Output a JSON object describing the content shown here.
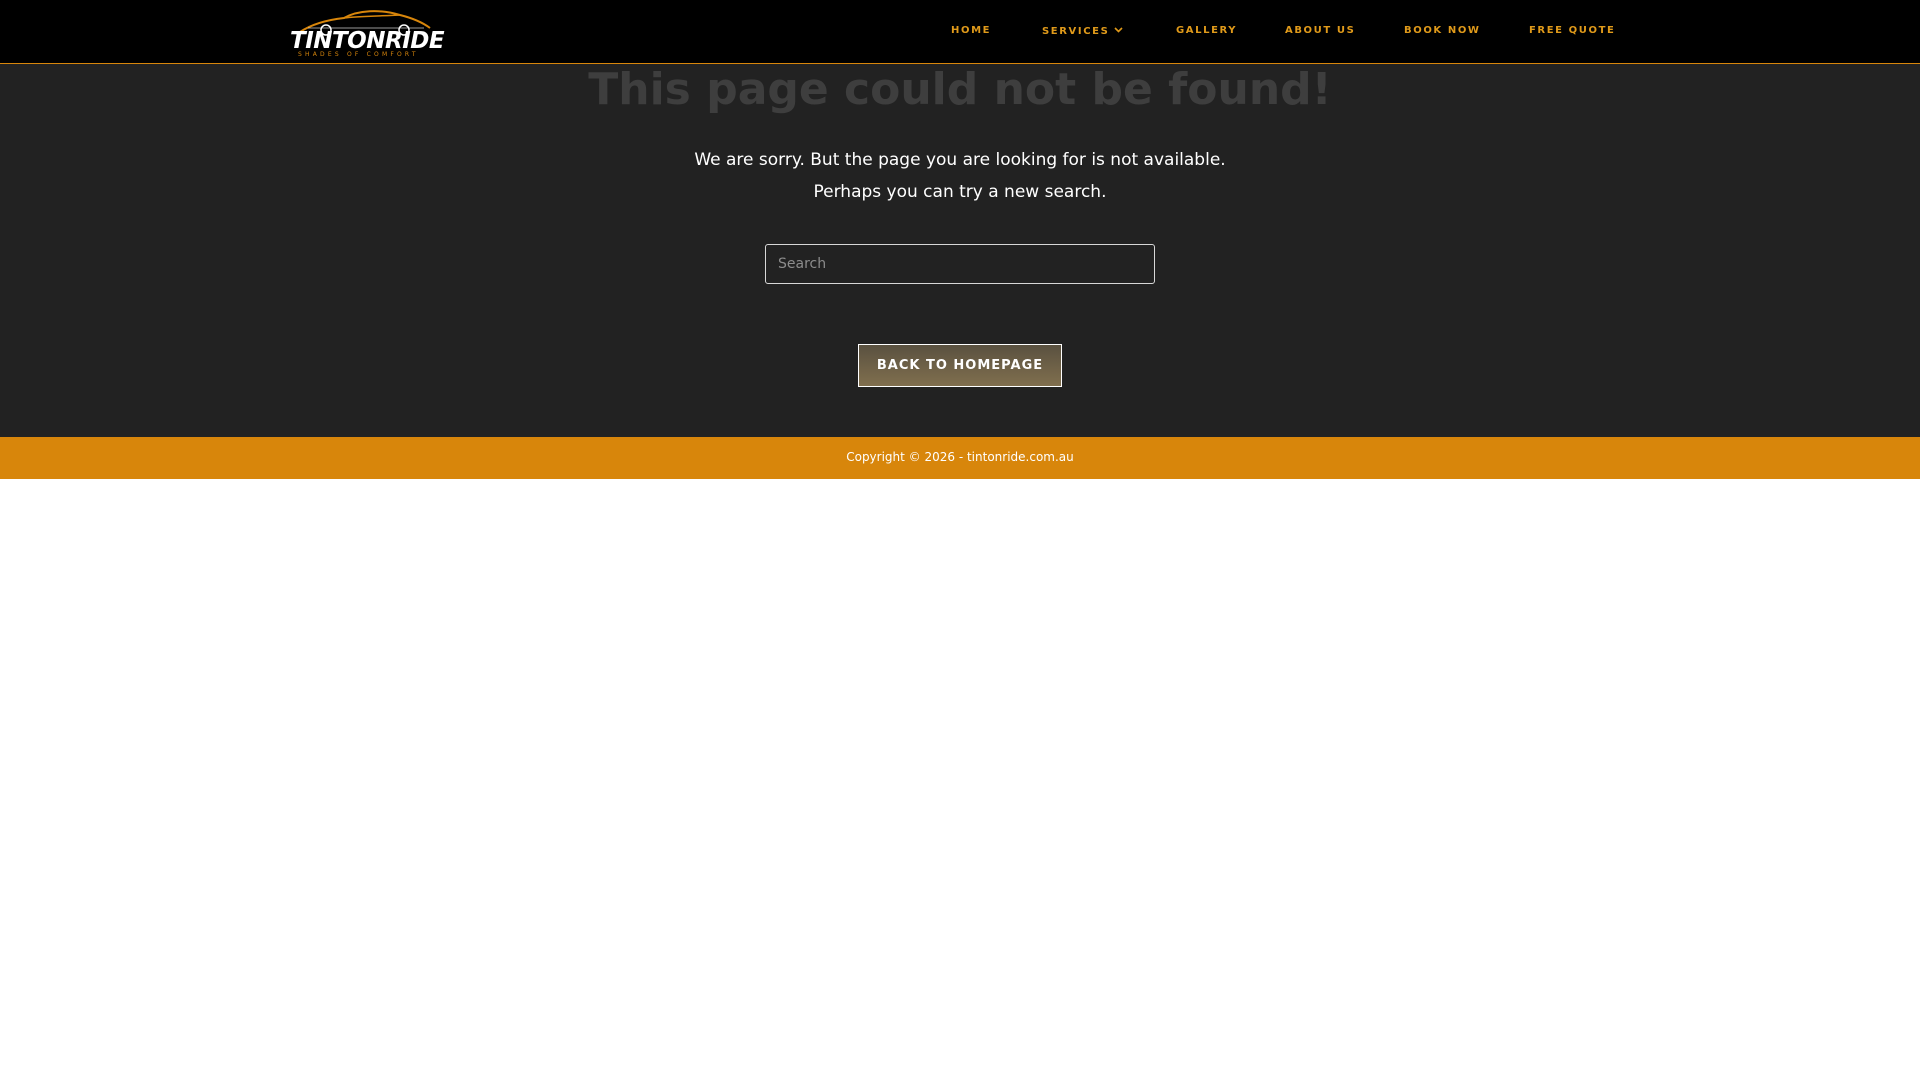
{
  "logo": {
    "name": "TINTONRIDE",
    "tagline": "SHADES OF COMFORT"
  },
  "nav": {
    "items": [
      {
        "label": "HOME"
      },
      {
        "label": "SERVICES"
      },
      {
        "label": "GALLERY"
      },
      {
        "label": "ABOUT US"
      },
      {
        "label": "BOOK NOW"
      },
      {
        "label": "FREE QUOTE"
      }
    ]
  },
  "main": {
    "title": "This page could not be found!",
    "message_line1": "We are sorry. But the page you are looking for is not available.",
    "message_line2": "Perhaps you can try a new search.",
    "search_placeholder": "Search",
    "back_button": "BACK TO HOMEPAGE"
  },
  "footer": {
    "copyright": "Copyright © 2026 - tintonride.com.au"
  },
  "colors": {
    "accent": "#d8860b",
    "nav_text": "#e09a1a",
    "header_bg": "#000000",
    "content_bg": "#222222"
  }
}
